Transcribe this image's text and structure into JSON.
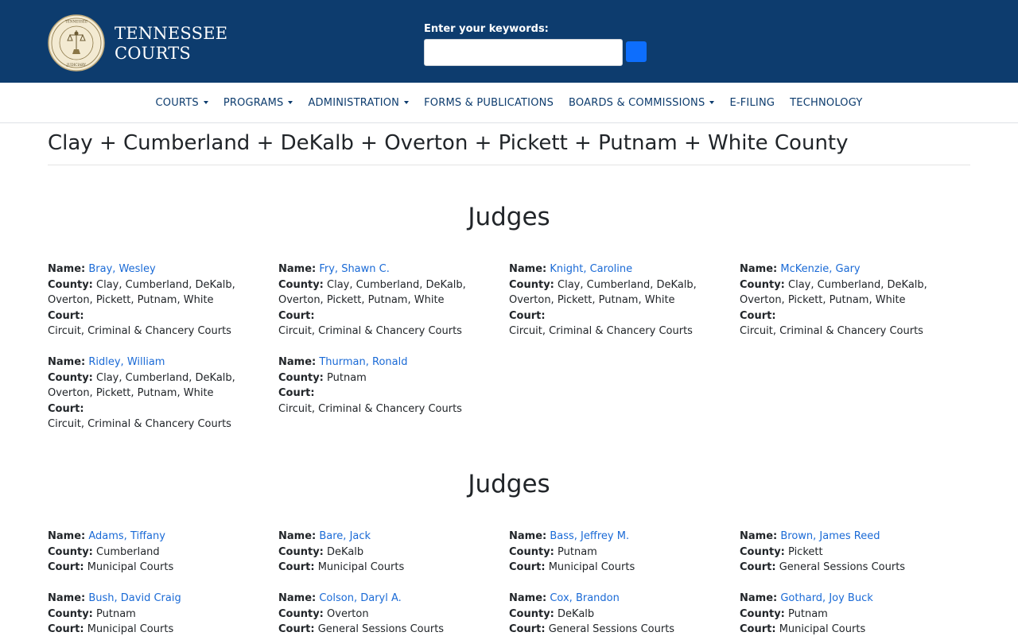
{
  "header": {
    "logo_line1": "TENNESSEE",
    "logo_line2": "COURTS",
    "seal_text": "SEAL OF THE TENNESSEE JUDICIARY",
    "search_label": "Enter your keywords:",
    "search_value": ""
  },
  "nav": {
    "items": [
      {
        "label": "COURTS",
        "dropdown": true
      },
      {
        "label": "PROGRAMS",
        "dropdown": true
      },
      {
        "label": "ADMINISTRATION",
        "dropdown": true
      },
      {
        "label": "FORMS & PUBLICATIONS",
        "dropdown": false
      },
      {
        "label": "BOARDS & COMMISSIONS",
        "dropdown": true
      },
      {
        "label": "E-FILING",
        "dropdown": false
      },
      {
        "label": "TECHNOLOGY",
        "dropdown": false
      }
    ]
  },
  "page": {
    "title": "Clay + Cumberland + DeKalb + Overton + Pickett + Putnam + White County"
  },
  "labels": {
    "name": "Name:",
    "county": "County:",
    "court": "Court:"
  },
  "sections": [
    {
      "heading": "Judges",
      "judges": [
        {
          "name": "Bray, Wesley",
          "county": "Clay, Cumberland, DeKalb, Overton, Pickett, Putnam, White",
          "court": "Circuit, Criminal & Chancery Courts"
        },
        {
          "name": "Fry, Shawn C.",
          "county": "Clay, Cumberland, DeKalb, Overton, Pickett, Putnam, White",
          "court": "Circuit, Criminal & Chancery Courts"
        },
        {
          "name": "Knight, Caroline",
          "county": "Clay, Cumberland, DeKalb, Overton, Pickett, Putnam, White",
          "court": "Circuit, Criminal & Chancery Courts"
        },
        {
          "name": "McKenzie, Gary",
          "county": "Clay, Cumberland, DeKalb, Overton, Pickett, Putnam, White",
          "court": "Circuit, Criminal & Chancery Courts"
        },
        {
          "name": "Ridley, William",
          "county": "Clay, Cumberland, DeKalb, Overton, Pickett, Putnam, White",
          "court": "Circuit, Criminal & Chancery Courts"
        },
        {
          "name": "Thurman, Ronald",
          "county": "Putnam",
          "court": "Circuit, Criminal & Chancery Courts"
        }
      ]
    },
    {
      "heading": "Judges",
      "judges": [
        {
          "name": "Adams, Tiffany",
          "county": "Cumberland",
          "court": "Municipal Courts"
        },
        {
          "name": "Bare, Jack",
          "county": "DeKalb",
          "court": "Municipal Courts"
        },
        {
          "name": "Bass, Jeffrey M.",
          "county": "Putnam",
          "court": "Municipal Courts"
        },
        {
          "name": "Brown, James Reed",
          "county": "Pickett",
          "court": "General Sessions Courts"
        },
        {
          "name": "Bush, David Craig",
          "county": "Putnam",
          "court": "Municipal Courts"
        },
        {
          "name": "Colson, Daryl A.",
          "county": "Overton",
          "court": "General Sessions Courts"
        },
        {
          "name": "Cox, Brandon",
          "county": "DeKalb",
          "court": "General Sessions Courts"
        },
        {
          "name": "Gothard, Joy Buck",
          "county": "Putnam",
          "court": "Municipal Courts"
        }
      ]
    }
  ]
}
